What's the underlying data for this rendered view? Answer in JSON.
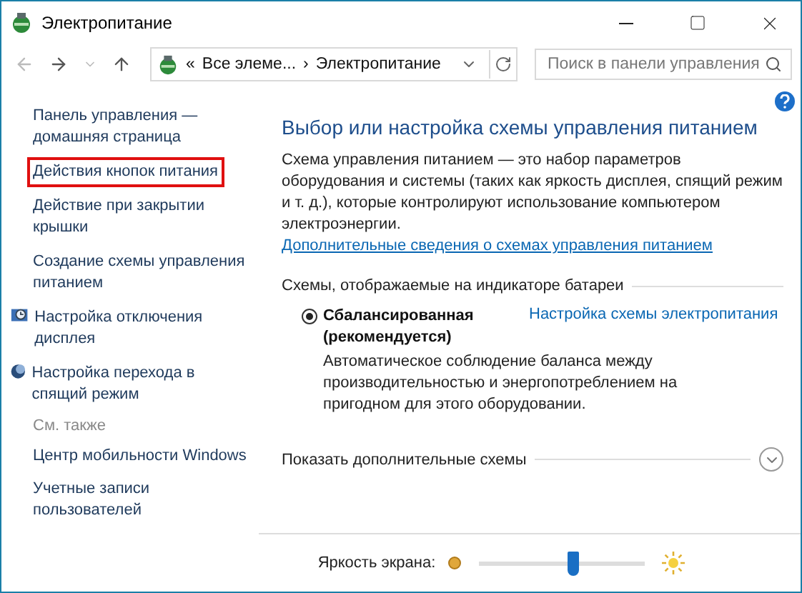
{
  "window": {
    "title": "Электропитание"
  },
  "address": {
    "segments": [
      "«",
      "Все элеме...",
      "›",
      "Электропитание"
    ],
    "search_placeholder": "Поиск в панели управления"
  },
  "sidebar": {
    "items": [
      {
        "label": "Панель управления — домашняя страница",
        "kind": "plain",
        "highlighted": false
      },
      {
        "label": "Действия кнопок питания",
        "kind": "plain",
        "highlighted": true
      },
      {
        "label": "Действие при закрытии крышки",
        "kind": "plain",
        "highlighted": false
      },
      {
        "label": "Создание схемы управления питанием",
        "kind": "plain",
        "highlighted": false
      },
      {
        "label": "Настройка отключения дисплея",
        "kind": "display",
        "highlighted": false
      },
      {
        "label": "Настройка перехода в спящий режим",
        "kind": "sleep",
        "highlighted": false
      }
    ],
    "see_also_title": "См. также",
    "see_also": [
      "Центр мобильности Windows",
      "Учетные записи пользователей"
    ]
  },
  "main": {
    "heading": "Выбор или настройка схемы управления питанием",
    "description": "Схема управления питанием — это набор параметров оборудования и системы (таких как яркость дисплея, спящий режим и т. д.), которые контролируют использование компьютером электроэнергии.",
    "description_link": "Дополнительные сведения о схемах управления питанием",
    "group_title": "Схемы, отображаемые на индикаторе батареи",
    "plans": [
      {
        "name": "Сбалансированная (рекомендуется)",
        "selected": true,
        "link": "Настройка схемы электропитания",
        "description": "Автоматическое соблюдение баланса между производительностью и энергопотреблением на пригодном для этого оборудовании."
      }
    ],
    "more_plans": "Показать дополнительные схемы",
    "brightness": {
      "label": "Яркость экрана:",
      "level": 0.57
    }
  }
}
